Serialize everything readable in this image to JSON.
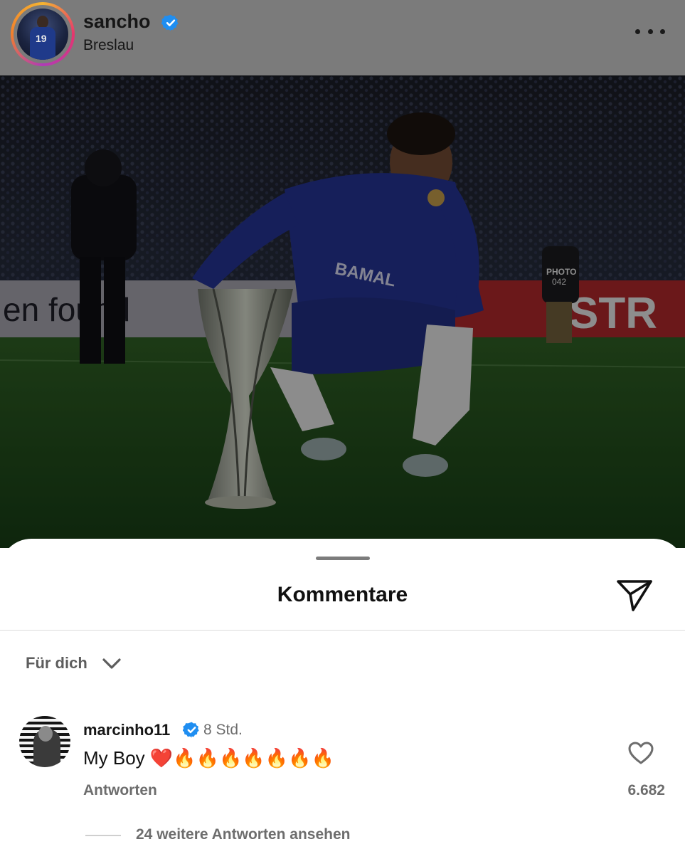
{
  "post": {
    "username": "sancho",
    "verified": true,
    "location": "Breslau",
    "more_icon": "more-horizontal-icon",
    "avatar_jersey_number": "19"
  },
  "photo": {
    "board_texts": [
      "en found",
      "STR"
    ],
    "shirt_sponsor": "BAMAL",
    "photographer_vest_label": "PHOTO",
    "photographer_vest_number": "042"
  },
  "media": {
    "mute_icon": "speaker-muted-icon"
  },
  "comments_sheet": {
    "title": "Kommentare",
    "share_icon": "send-icon",
    "sort": {
      "label": "Für dich",
      "icon": "chevron-down-icon"
    },
    "comments": [
      {
        "username": "marcinho11",
        "verified": true,
        "time": "8 Std.",
        "text": "My Boy ❤️🔥🔥🔥🔥🔥🔥🔥",
        "reply_label": "Antworten",
        "likes": "6.682",
        "view_replies_label": "24 weitere Antworten ansehen"
      }
    ]
  },
  "colors": {
    "verified_blue": "#1f8ef1",
    "header_bg": "#7b7b7b",
    "secondary_text": "#6d6d6d"
  }
}
